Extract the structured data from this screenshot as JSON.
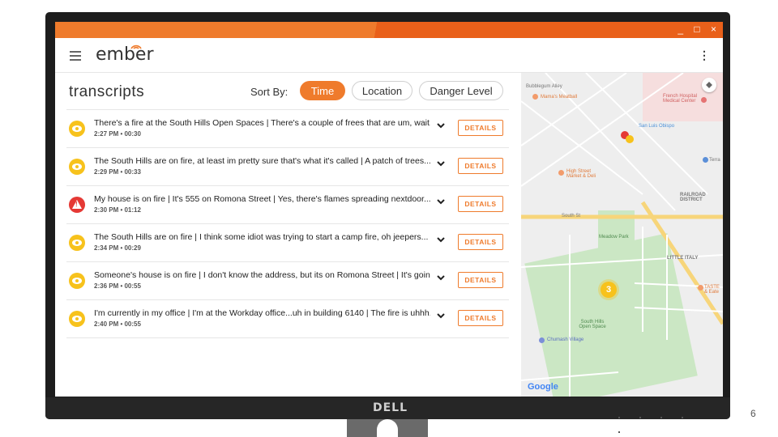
{
  "window": {
    "controls": [
      "_",
      "□",
      "×"
    ]
  },
  "app": {
    "logo_text": "ember"
  },
  "transcripts": {
    "heading": "transcripts",
    "sort_label": "Sort By:",
    "sort_options": [
      "Time",
      "Location",
      "Danger Level"
    ],
    "active_sort": "Time",
    "details_label": "DETAILS",
    "items": [
      {
        "status": "watch",
        "text": "There's a fire at the South Hills Open Spaces | There's a couple of frees that are um, wait...",
        "meta": "2:27 PM • 00:30"
      },
      {
        "status": "watch",
        "text": "The South Hills are on fire, at least im pretty sure that's what it's called | A patch of trees...",
        "meta": "2:29 PM • 00:33"
      },
      {
        "status": "danger",
        "text": "My house is on fire | It's 555 on Romona Street | Yes, there's flames spreading nextdoor...",
        "meta": "2:30 PM • 01:12"
      },
      {
        "status": "watch",
        "text": "The South Hills are on fire | I think some idiot was trying to start a camp fire, oh jeepers...",
        "meta": "2:34 PM • 00:29"
      },
      {
        "status": "watch",
        "text": "Someone's house is on fire | I don't know the address, but its on Romona Street | It's going...",
        "meta": "2:36 PM • 00:55"
      },
      {
        "status": "watch",
        "text": "I'm currently in my office | I'm at the Workday office...uh in building 6140 | The fire is uhhh...",
        "meta": "2:40 PM • 00:55"
      }
    ]
  },
  "map": {
    "cluster_count": "3",
    "labels": {
      "bubblegum": "Bubblegum Alley",
      "mamas": "Mama's Meatball",
      "french": "French Hospital Medical Center",
      "slo": "San Luis Obispo",
      "high_street": "High Street Market & Deli",
      "railroad": "RAILROAD DISTRICT",
      "south_st": "South St",
      "meadow": "Meadow Park",
      "little_italy": "LITTLE ITALY",
      "south_hills": "South Hills Open Space",
      "chumash": "Chumash Village",
      "terra": "Terra",
      "taste": "TASTE & Eate"
    },
    "attribution": "Google"
  },
  "monitor": {
    "brand": "DELL",
    "slide_number": "6"
  },
  "colors": {
    "accent": "#ef7b2c",
    "watch": "#f7c21c",
    "danger": "#e53935"
  }
}
